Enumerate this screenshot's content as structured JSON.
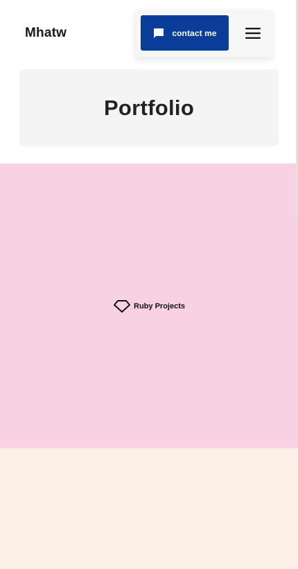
{
  "header": {
    "brand": "Mhatw",
    "contact_label": "contact me",
    "contact_icon": "chat-bubble-icon",
    "menu_icon": "hamburger-menu-icon"
  },
  "hero": {
    "title": "Portfolio"
  },
  "projects": [
    {
      "label": "Ruby Projects",
      "icon": "ruby-gem-icon",
      "background": "#f8d2e2"
    }
  ],
  "colors": {
    "accent": "#0a3d99",
    "pink_section": "#f8d2e2",
    "cream_section": "#fdf0e6"
  }
}
